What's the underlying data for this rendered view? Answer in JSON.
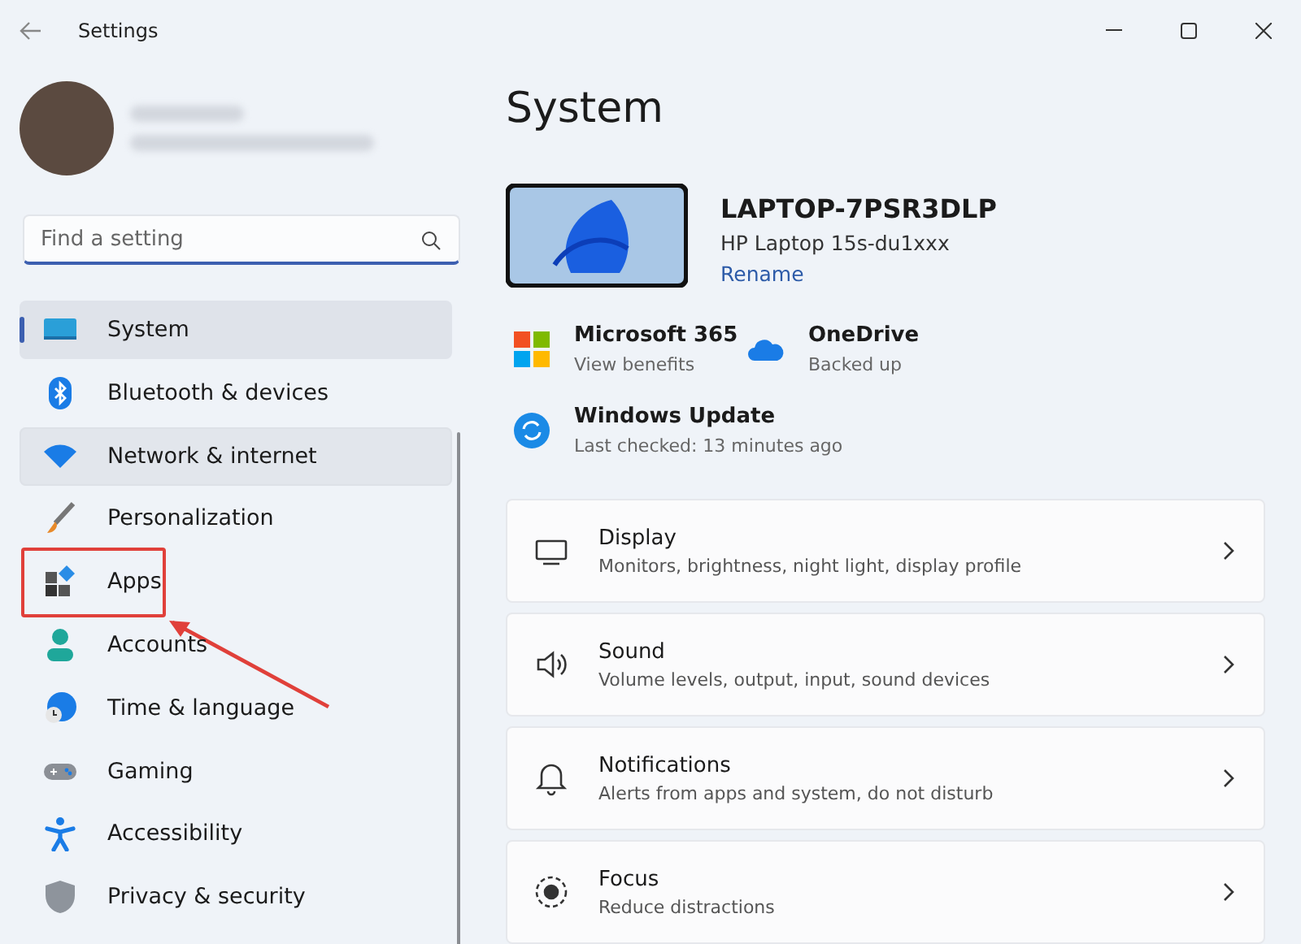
{
  "window": {
    "title": "Settings"
  },
  "search": {
    "placeholder": "Find a setting"
  },
  "nav": [
    {
      "label": "System",
      "kind": "system",
      "selected": true,
      "hovered": false,
      "marked": false
    },
    {
      "label": "Bluetooth & devices",
      "kind": "bluetooth",
      "selected": false,
      "hovered": false,
      "marked": false
    },
    {
      "label": "Network & internet",
      "kind": "network",
      "selected": false,
      "hovered": true,
      "marked": false
    },
    {
      "label": "Personalization",
      "kind": "personalization",
      "selected": false,
      "hovered": false,
      "marked": false
    },
    {
      "label": "Apps",
      "kind": "apps",
      "selected": false,
      "hovered": false,
      "marked": true
    },
    {
      "label": "Accounts",
      "kind": "accounts",
      "selected": false,
      "hovered": false,
      "marked": false
    },
    {
      "label": "Time & language",
      "kind": "time",
      "selected": false,
      "hovered": false,
      "marked": false
    },
    {
      "label": "Gaming",
      "kind": "gaming",
      "selected": false,
      "hovered": false,
      "marked": false
    },
    {
      "label": "Accessibility",
      "kind": "accessibility",
      "selected": false,
      "hovered": false,
      "marked": false
    },
    {
      "label": "Privacy & security",
      "kind": "privacy",
      "selected": false,
      "hovered": false,
      "marked": false
    }
  ],
  "page": {
    "title": "System",
    "device": {
      "name": "LAPTOP-7PSR3DLP",
      "model": "HP Laptop 15s-du1xxx",
      "link": "Rename"
    },
    "tiles": [
      {
        "kind": "office",
        "title": "Microsoft 365",
        "subtitle": "View benefits"
      },
      {
        "kind": "storage",
        "title": "OneDrive",
        "subtitle": "Backed up"
      },
      {
        "kind": "update",
        "title": "Windows Update",
        "subtitle": "Last checked: 13 minutes ago"
      }
    ],
    "cards": [
      {
        "kind": "display",
        "title": "Display",
        "subtitle": "Monitors, brightness, night light, display profile"
      },
      {
        "kind": "sound",
        "title": "Sound",
        "subtitle": "Volume levels, output, input, sound devices"
      },
      {
        "kind": "notifications",
        "title": "Notifications",
        "subtitle": "Alerts from apps and system, do not disturb"
      },
      {
        "kind": "focus",
        "title": "Focus",
        "subtitle": "Reduce distractions"
      }
    ]
  }
}
